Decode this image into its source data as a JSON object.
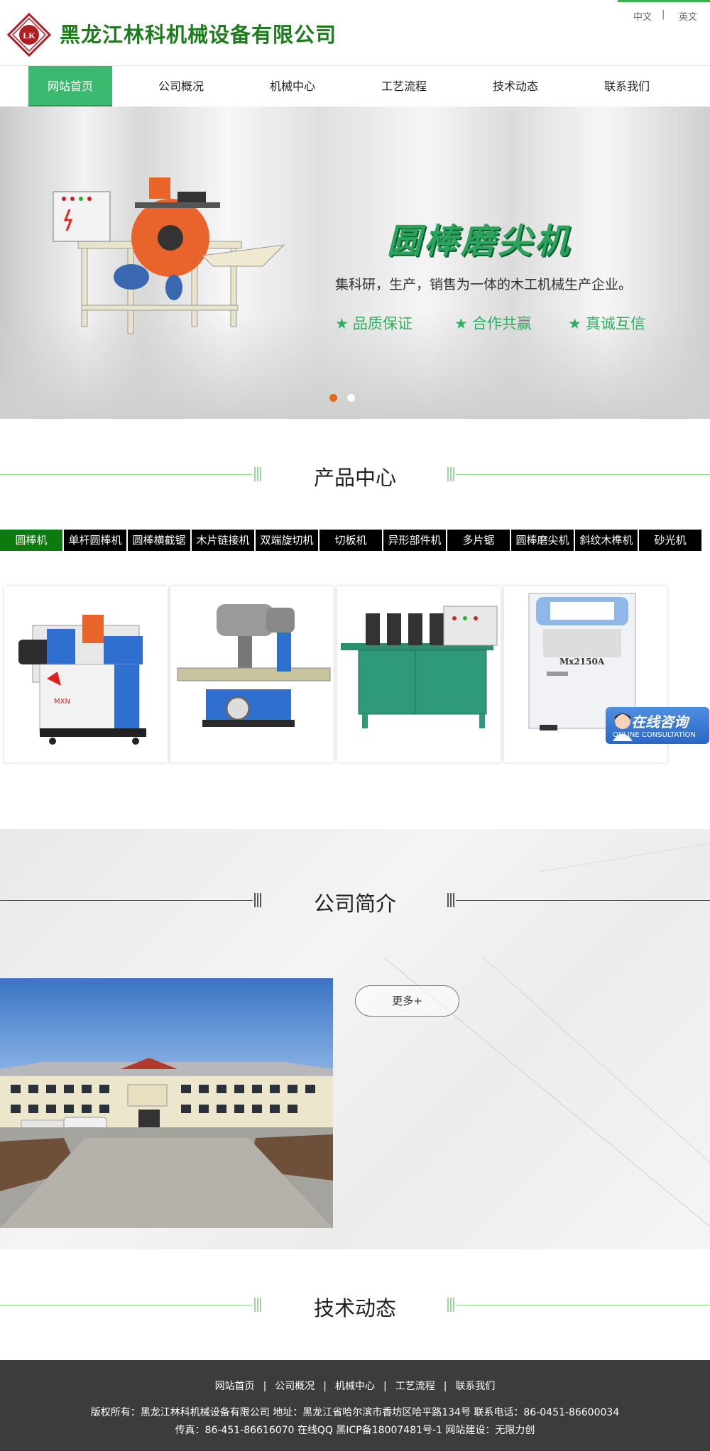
{
  "header": {
    "company_name": "黑龙江林科机械设备有限公司",
    "lang_cn": "中文",
    "lang_sep": "|",
    "lang_en": "英文",
    "logo_letters": "LK",
    "brand_color": "#1e7b1e"
  },
  "nav": {
    "items": [
      {
        "label": "网站首页",
        "active": true
      },
      {
        "label": "公司概况"
      },
      {
        "label": "机械中心"
      },
      {
        "label": "工艺流程"
      },
      {
        "label": "技术动态"
      },
      {
        "label": "联系我们"
      }
    ],
    "active_color": "#3cb971"
  },
  "banner": {
    "title": "圆棒磨尖机",
    "subtitle": "集科研，生产，销售为一体的木工机械生产企业。",
    "features": [
      "品质保证",
      "合作共赢",
      "真诚互信"
    ],
    "star_icon": "★",
    "slide_count": 2,
    "active_slide": 1
  },
  "products": {
    "title": "产品中心",
    "tabs": [
      "圆棒机",
      "单杆圆棒机",
      "圆棒横截锯",
      "木片链接机",
      "双端旋切机",
      "切板机",
      "异形部件机",
      "多片锯",
      "圆棒磨尖机",
      "斜纹木榫机",
      "砂光机"
    ],
    "active_tab": 0,
    "cards": [
      {
        "name": "product-roundbar-machine",
        "print": "MXN"
      },
      {
        "name": "product-milling-machine"
      },
      {
        "name": "product-green-machine"
      },
      {
        "name": "product-cutoff-saw",
        "print": "Mx2150A"
      }
    ]
  },
  "consult": {
    "title": "在线咨询",
    "subtitle": "ONLINE CONSULTATION"
  },
  "about": {
    "title": "公司简介",
    "more_label": "更多+"
  },
  "news": {
    "title": "技术动态"
  },
  "footer": {
    "nav": [
      "网站首页",
      "公司概况",
      "机械中心",
      "工艺流程",
      "联系我们"
    ],
    "sep": "|",
    "line1": "版权所有：黑龙江林科机械设备有限公司 地址：黑龙江省哈尔滨市香坊区哈平路134号 联系电话：86-0451-86600034",
    "line2": "传真：86-451-86616070 在线QQ 黑ICP备18007481号-1 网站建设：无限力创"
  },
  "colors": {
    "green": "#3cb24a",
    "tab_active": "#0d7a0d",
    "footer_bg": "#3c3c3c",
    "slide_dot_active": "#e06a1a"
  }
}
